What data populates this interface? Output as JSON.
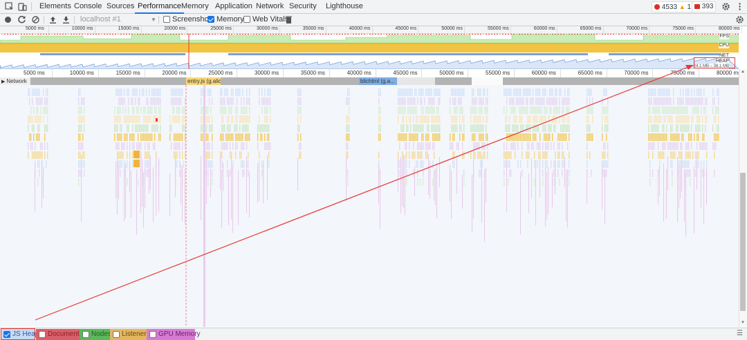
{
  "tabs": [
    "Elements",
    "Console",
    "Sources",
    "Performance",
    "Memory",
    "Application",
    "Network",
    "Security",
    "Lighthouse"
  ],
  "active_tab": "Performance",
  "errors_count": "4533",
  "warnings_count": "1",
  "issues_count": "393",
  "toolbar": {
    "recording_select": "localhost #1",
    "screenshots_label": "Screenshots",
    "memory_label": "Memory",
    "web_vitals_label": "Web Vitals",
    "screenshots_checked": false,
    "memory_checked": true,
    "web_vitals_checked": false
  },
  "overview": {
    "ticks": [
      "5000 ms",
      "10000 ms",
      "15000 ms",
      "20000 ms",
      "25000 ms",
      "30000 ms",
      "35000 ms",
      "40000 ms",
      "45000 ms",
      "50000 ms",
      "55000 ms",
      "60000 ms",
      "65000 ms",
      "70000 ms",
      "75000 ms",
      "80000 ms"
    ],
    "fps_label": "FPS",
    "cpu_label": "CPU",
    "net_label": "NET",
    "heap_label": "HEAP",
    "heap_range": "24.1 MB – 38.1 MB"
  },
  "ruler": {
    "ticks": [
      "5000 ms",
      "10000 ms",
      "15000 ms",
      "20000 ms",
      "25000 ms",
      "30000 ms",
      "35000 ms",
      "40000 ms",
      "45000 ms",
      "50000 ms",
      "55000 ms",
      "60000 ms",
      "65000 ms",
      "70000 ms",
      "75000 ms",
      "80000 ms"
    ]
  },
  "network": {
    "label": "Network",
    "requests": [
      {
        "name": "entry.js (g.alic"
      },
      {
        "name": "blichtml (g.a..."
      }
    ]
  },
  "counters": [
    {
      "label": "JS Heap",
      "checked": true,
      "color": "#6b9bd8"
    },
    {
      "label": "Documents",
      "checked": false,
      "color": "#d9606a"
    },
    {
      "label": "Nodes",
      "checked": false,
      "color": "#5cb85c"
    },
    {
      "label": "Listeners",
      "checked": false,
      "color": "#e4b660"
    },
    {
      "label": "GPU Memory",
      "checked": false,
      "color": "#d67ad6"
    }
  ],
  "colors": {
    "accent": "#1a73e8",
    "cpu_scripting": "#f2c443",
    "fps_green": "#9bdb7d",
    "annotation_red": "#e53935"
  }
}
